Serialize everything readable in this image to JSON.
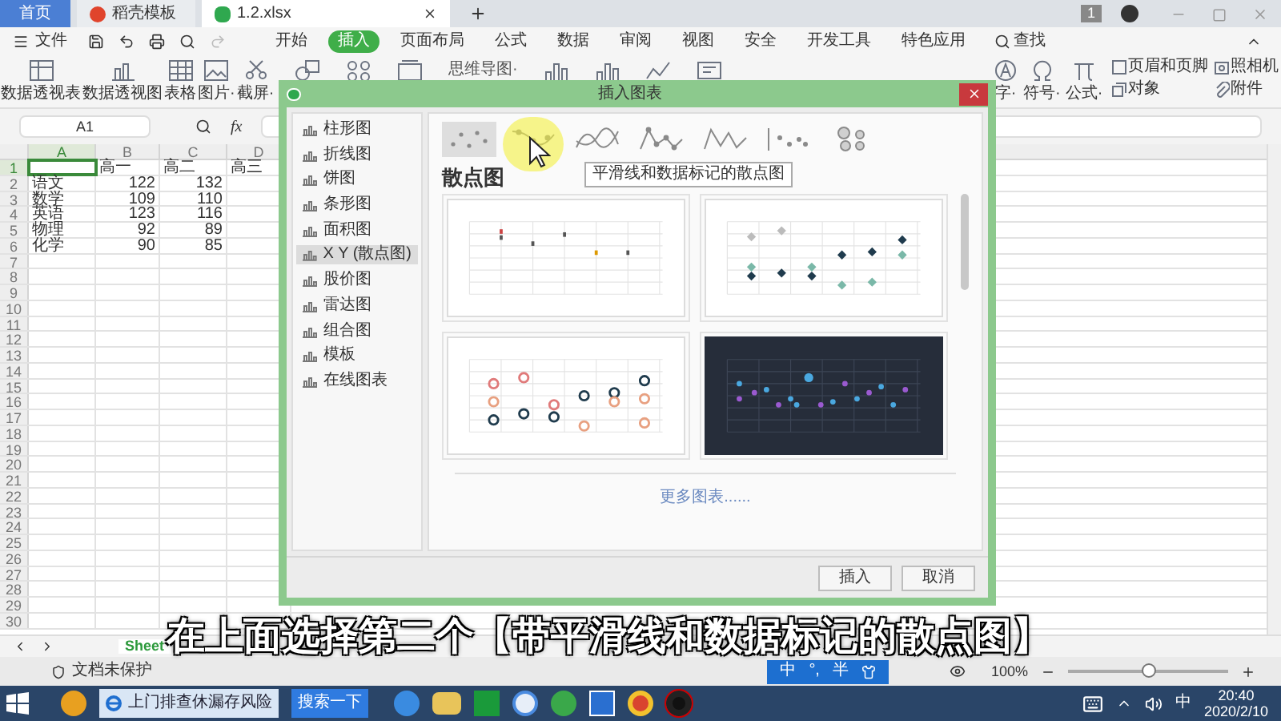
{
  "tabs": [
    {
      "label": "首页",
      "kind": "home",
      "selected": false
    },
    {
      "label": "稻壳模板",
      "kind": "template",
      "selected": false
    },
    {
      "label": "1.2.xlsx",
      "kind": "sheet",
      "selected": true
    }
  ],
  "account": {
    "badge": "1"
  },
  "menu": {
    "file": "文件",
    "items": [
      {
        "label": "开始",
        "selected": false
      },
      {
        "label": "插入",
        "selected": true
      },
      {
        "label": "页面布局",
        "selected": false
      },
      {
        "label": "公式",
        "selected": false
      },
      {
        "label": "数据",
        "selected": false
      },
      {
        "label": "审阅",
        "selected": false
      },
      {
        "label": "视图",
        "selected": false
      },
      {
        "label": "安全",
        "selected": false
      },
      {
        "label": "开发工具",
        "selected": false
      },
      {
        "label": "特色应用",
        "selected": false
      }
    ],
    "search": "查找"
  },
  "ribbon": {
    "left": [
      {
        "label": "数据透视表",
        "kind": "pivot"
      },
      {
        "label": "数据透视图",
        "kind": "pivot-chart"
      },
      {
        "label": "表格",
        "kind": "table"
      },
      {
        "label": "图片·",
        "kind": "picture"
      },
      {
        "label": "截屏·",
        "kind": "screenshot"
      }
    ],
    "mind_map": "思维导图·",
    "right": [
      {
        "label": "字·",
        "kind": "art"
      },
      {
        "label": "符号·",
        "kind": "symbol"
      },
      {
        "label": "公式·",
        "kind": "formula"
      }
    ],
    "stacked": [
      {
        "label": "页眉和页脚",
        "kind": "header"
      },
      {
        "label": "照相机",
        "kind": "camera"
      },
      {
        "label": "对象",
        "kind": "object"
      },
      {
        "label": "附件",
        "kind": "attach"
      }
    ]
  },
  "formula_bar": {
    "name_box": "A1",
    "fx": "fx"
  },
  "sheet": {
    "columns": [
      {
        "label": "A",
        "selected": true
      },
      {
        "label": "B",
        "selected": false
      },
      {
        "label": "C",
        "selected": false
      },
      {
        "label": "D",
        "selected": false
      }
    ],
    "rows": [
      {
        "number": "1",
        "selected": true,
        "cells": {
          "B": "高一",
          "C": "高二",
          "D": "高三"
        }
      },
      {
        "number": "2",
        "selected": false,
        "cells": {
          "A": "语文",
          "B": "122",
          "C": "132"
        }
      },
      {
        "number": "3",
        "selected": false,
        "cells": {
          "A": "数学",
          "B": "109",
          "C": "110"
        }
      },
      {
        "number": "4",
        "selected": false,
        "cells": {
          "A": "英语",
          "B": "123",
          "C": "116"
        }
      },
      {
        "number": "5",
        "selected": false,
        "cells": {
          "A": "物理",
          "B": "92",
          "C": "89"
        }
      },
      {
        "number": "6",
        "selected": false,
        "cells": {
          "A": "化学",
          "B": "90",
          "C": "85"
        }
      },
      {
        "number": "7",
        "selected": false
      },
      {
        "number": "8",
        "selected": false
      },
      {
        "number": "9",
        "selected": false
      },
      {
        "number": "10",
        "selected": false
      },
      {
        "number": "11",
        "selected": false
      },
      {
        "number": "12",
        "selected": false
      },
      {
        "number": "13",
        "selected": false
      },
      {
        "number": "14",
        "selected": false
      },
      {
        "number": "15",
        "selected": false
      },
      {
        "number": "16",
        "selected": false
      },
      {
        "number": "17",
        "selected": false
      },
      {
        "number": "18",
        "selected": false
      },
      {
        "number": "19",
        "selected": false
      },
      {
        "number": "20",
        "selected": false
      },
      {
        "number": "21",
        "selected": false
      },
      {
        "number": "22",
        "selected": false
      },
      {
        "number": "23",
        "selected": false
      },
      {
        "number": "24",
        "selected": false
      },
      {
        "number": "25",
        "selected": false
      },
      {
        "number": "26",
        "selected": false
      },
      {
        "number": "27",
        "selected": false
      },
      {
        "number": "28",
        "selected": false
      },
      {
        "number": "29",
        "selected": false
      },
      {
        "number": "30",
        "selected": false
      }
    ],
    "sheet_tabs": [
      {
        "label": "Sheet",
        "selected": true
      }
    ]
  },
  "dialog": {
    "title": "插入图表",
    "categories": [
      {
        "label": "柱形图",
        "selected": false
      },
      {
        "label": "折线图",
        "selected": false
      },
      {
        "label": "饼图",
        "selected": false
      },
      {
        "label": "条形图",
        "selected": false
      },
      {
        "label": "面积图",
        "selected": false
      },
      {
        "label": "X Y (散点图)",
        "selected": true
      },
      {
        "label": "股价图",
        "selected": false
      },
      {
        "label": "雷达图",
        "selected": false
      },
      {
        "label": "组合图",
        "selected": false
      },
      {
        "label": "模板",
        "selected": false
      },
      {
        "label": "在线图表",
        "selected": false
      }
    ],
    "chart_types": [
      {
        "kind": "scatter",
        "selected": true,
        "hovered": false
      },
      {
        "kind": "smooth-markers",
        "selected": false,
        "hovered": true
      },
      {
        "kind": "smooth",
        "selected": false,
        "hovered": false
      },
      {
        "kind": "straight-markers",
        "selected": false,
        "hovered": false
      },
      {
        "kind": "straight",
        "selected": false,
        "hovered": false
      },
      {
        "kind": "dots",
        "selected": false,
        "hovered": false
      },
      {
        "kind": "bubble",
        "selected": false,
        "hovered": false
      }
    ],
    "tooltip": "平滑线和数据标记的散点图",
    "heading": "散点图",
    "templates": [
      {
        "kind": "plain"
      },
      {
        "kind": "diamond"
      },
      {
        "kind": "ring"
      },
      {
        "kind": "dark"
      }
    ],
    "more_link": "更多图表......",
    "buttons": [
      "插入",
      "取消"
    ]
  },
  "status_bar": {
    "protection": "文档未保护",
    "ime": [
      "中",
      "°,",
      "半"
    ],
    "zoom": "100%",
    "zoom_level": {
      "level": 0.5
    }
  },
  "taskbar": {
    "window": "上门排查休漏存风险",
    "search": "搜索一下",
    "ime": "中",
    "time": "20:40",
    "date": "2020/2/10"
  },
  "caption": "在上面选择第二个【带平滑线和数据标记的散点图】"
}
